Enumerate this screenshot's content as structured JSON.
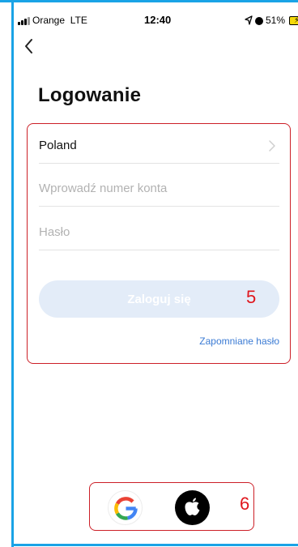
{
  "status_bar": {
    "carrier": "Orange",
    "network": "LTE",
    "time": "12:40",
    "battery": "51%"
  },
  "login": {
    "title": "Logowanie",
    "country": "Poland",
    "account_placeholder": "Wprowadź numer konta",
    "password_placeholder": "Hasło",
    "login_button": "Zaloguj się",
    "forgot_password": "Zapomniane hasło"
  },
  "annotations": {
    "form_marker": "5",
    "social_marker": "6"
  },
  "colors": {
    "accent_blue": "#1aa3e6",
    "annotation_red": "#cc1f27",
    "link_blue": "#3b7bd4",
    "button_disabled": "#e3ecf8"
  },
  "icons": {
    "back": "chevron-left-icon",
    "country_arrow": "chevron-right-icon",
    "social_google": "google-icon",
    "social_apple": "apple-icon"
  }
}
